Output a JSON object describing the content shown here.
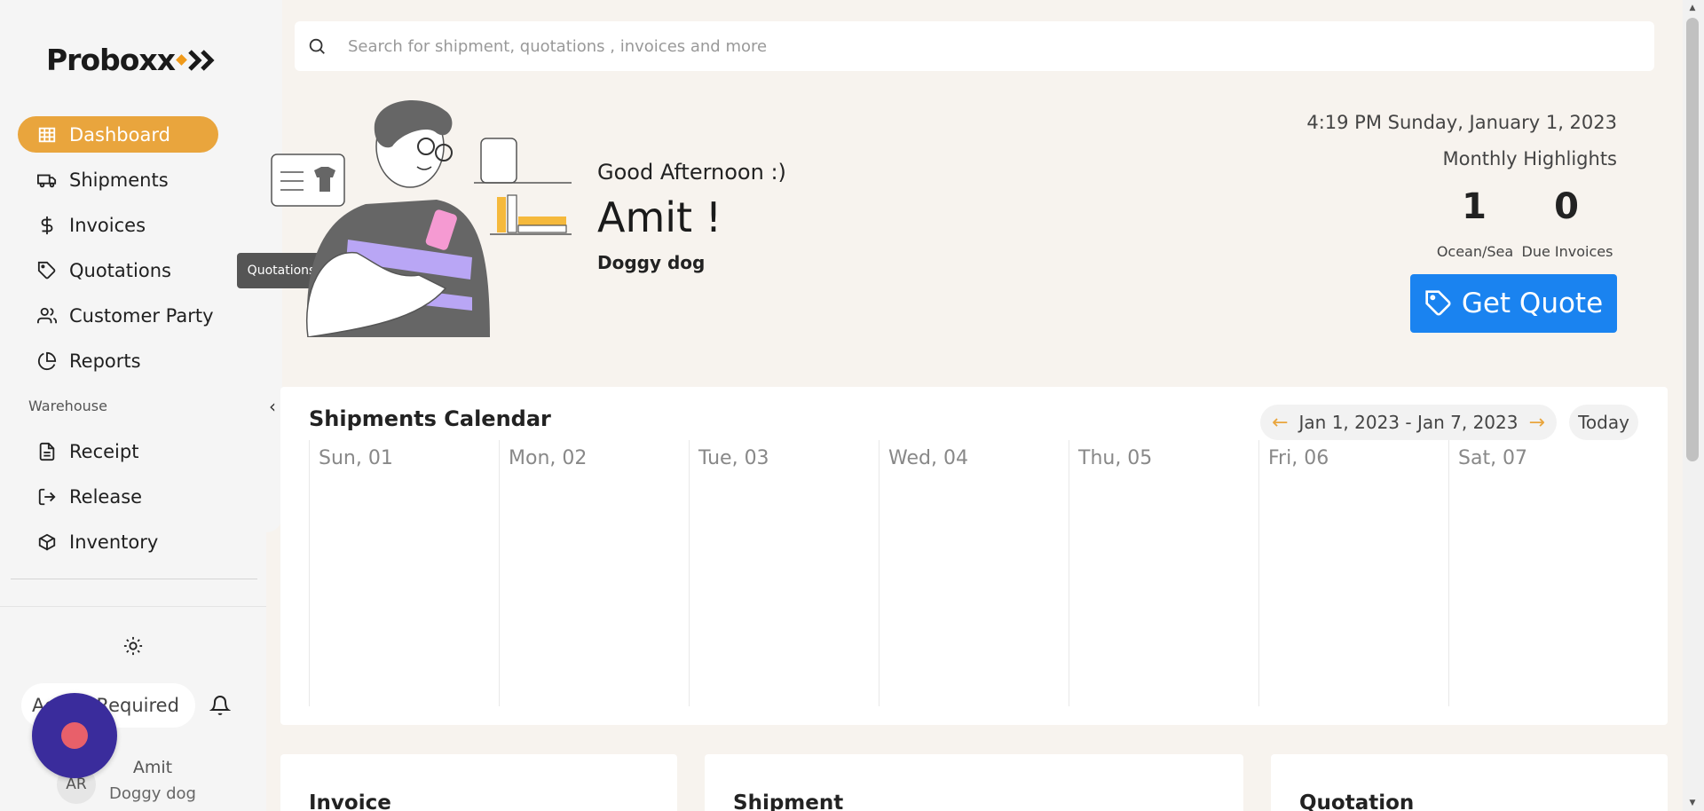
{
  "app": {
    "logo_text": "Proboxx"
  },
  "search": {
    "placeholder": "Search for shipment, quotations , invoices and more",
    "value": ""
  },
  "sidebar": {
    "items": [
      {
        "label": "Dashboard",
        "icon": "grid-icon",
        "active": true
      },
      {
        "label": "Shipments",
        "icon": "truck-icon"
      },
      {
        "label": "Invoices",
        "icon": "dollar-icon"
      },
      {
        "label": "Quotations",
        "icon": "tag-icon"
      },
      {
        "label": "Customer Party",
        "icon": "users-icon"
      },
      {
        "label": "Reports",
        "icon": "pie-chart-icon"
      }
    ],
    "section_label": "Warehouse",
    "warehouse_items": [
      {
        "label": "Receipt",
        "icon": "file-icon"
      },
      {
        "label": "Release",
        "icon": "logout-icon"
      },
      {
        "label": "Inventory",
        "icon": "box-icon"
      }
    ],
    "action_label": "Action Required",
    "user": {
      "initials": "AR",
      "name": "Amit",
      "org": "Doggy dog"
    }
  },
  "tooltip": {
    "text": "Quotations"
  },
  "hero": {
    "greeting": "Good Afternoon :)",
    "user_name": "Amit !",
    "org": "Doggy dog",
    "datetime": "4:19 PM Sunday, January 1, 2023",
    "highlights_title": "Monthly Highlights",
    "stats": [
      {
        "value": "1",
        "label": "Ocean/Sea"
      },
      {
        "value": "0",
        "label": "Due Invoices"
      }
    ],
    "quote_button": "Get Quote"
  },
  "calendar": {
    "title": "Shipments Calendar",
    "range": "Jan 1, 2023 - Jan 7, 2023",
    "today_label": "Today",
    "days": [
      "Sun, 01",
      "Mon, 02",
      "Tue, 03",
      "Wed, 04",
      "Thu, 05",
      "Fri, 06",
      "Sat, 07"
    ]
  },
  "cards": [
    {
      "title": "Invoice"
    },
    {
      "title": "Shipment"
    },
    {
      "title": "Quotation"
    }
  ],
  "colors": {
    "accent": "#e9a53d",
    "primary_button": "#1a83f0",
    "record_button": "#3a2c9c"
  }
}
